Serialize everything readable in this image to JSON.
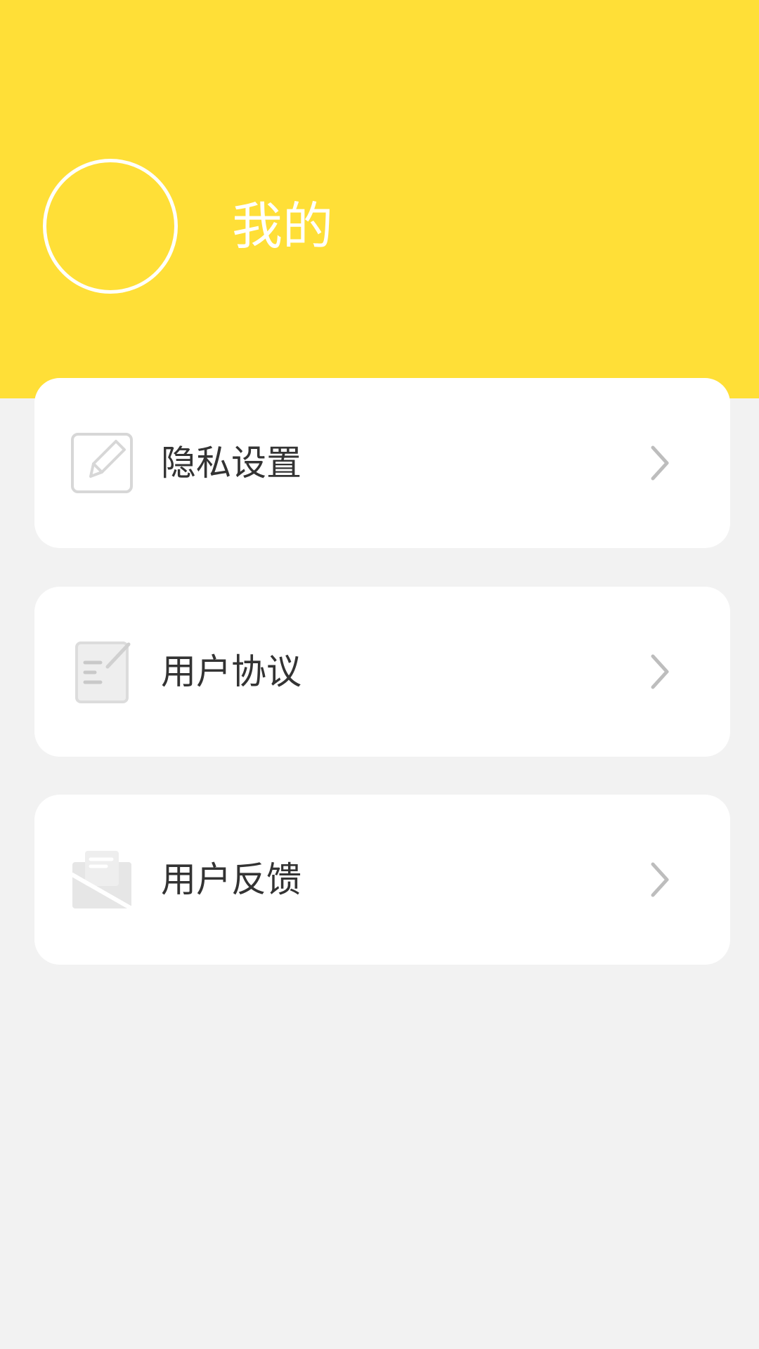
{
  "header": {
    "title": "我的",
    "background_color": "#ffdf37",
    "avatar": {
      "shape": "circle-outline",
      "border_color": "#ffffff"
    }
  },
  "menu": {
    "items": [
      {
        "label": "隐私设置",
        "icon": "edit-icon",
        "trailing_icon": "chevron-right-icon"
      },
      {
        "label": "用户协议",
        "icon": "document-icon",
        "trailing_icon": "chevron-right-icon"
      },
      {
        "label": "用户反馈",
        "icon": "mail-icon",
        "trailing_icon": "chevron-right-icon"
      }
    ]
  },
  "colors": {
    "page_background": "#f2f2f2",
    "card_background": "#ffffff",
    "label_text": "#333333",
    "icon_gray": "#d7d7d7",
    "chevron_gray": "#bdbdbd"
  }
}
